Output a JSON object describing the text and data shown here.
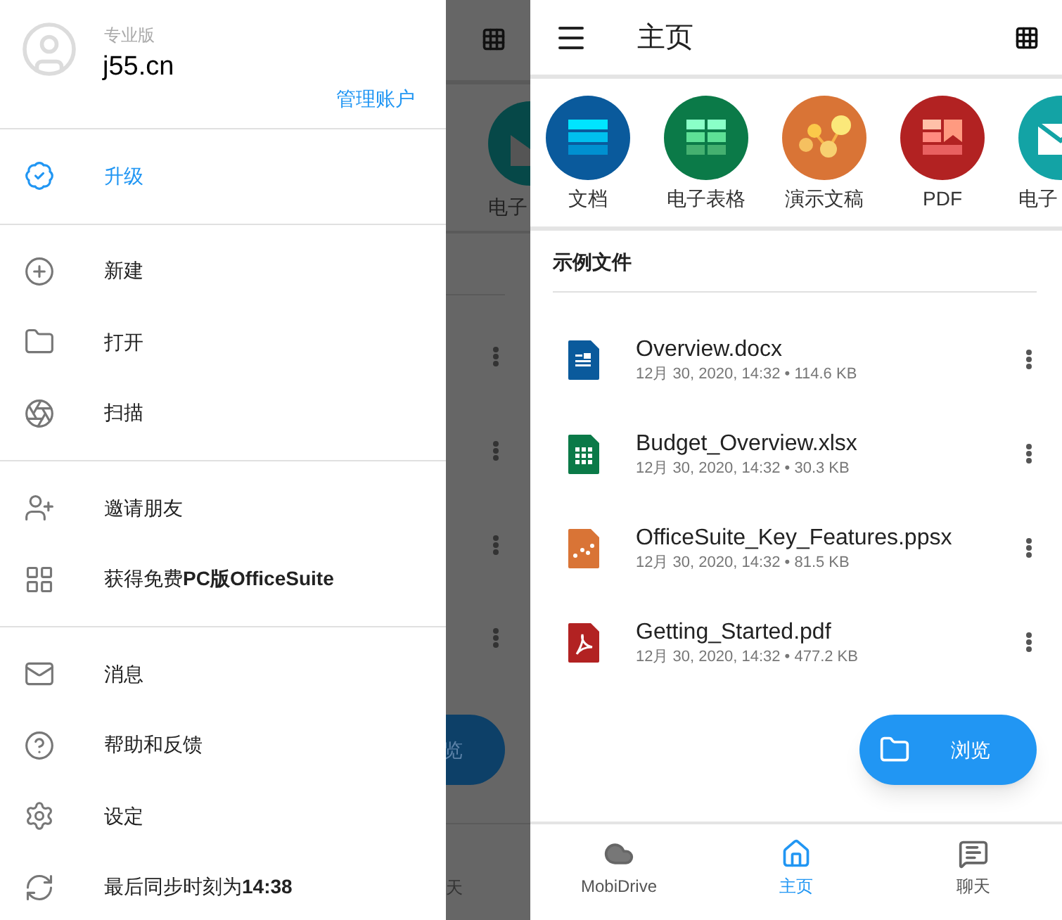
{
  "left_screen": {
    "drawer": {
      "edition": "专业版",
      "account": "j55.cn",
      "manage_link": "管理账户",
      "sections": [
        [
          {
            "label": "升级",
            "kind": "upgrade",
            "highlighted": true
          }
        ],
        [
          {
            "label": "新建",
            "kind": "new",
            "highlighted": false
          },
          {
            "label": "打开",
            "kind": "open",
            "highlighted": false
          },
          {
            "label": "扫描",
            "kind": "scan",
            "highlighted": false
          }
        ],
        [
          {
            "label": "邀请朋友",
            "kind": "invite",
            "highlighted": false
          },
          {
            "label": "获得免费**PC版OfficeSuite**",
            "kind": "windows",
            "highlighted": false
          }
        ],
        [
          {
            "label": "消息",
            "kind": "mail",
            "highlighted": false
          },
          {
            "label": "帮助和反馈",
            "kind": "help",
            "highlighted": false
          },
          {
            "label": "设定",
            "kind": "settings",
            "highlighted": false
          },
          {
            "label": "最后同步时刻为**14:38**",
            "kind": "sync",
            "highlighted": false
          }
        ]
      ]
    },
    "background": {
      "tile_label": "电子",
      "fab_label": "览",
      "nav_label": "天"
    }
  },
  "right_screen": {
    "title": "主页",
    "categories": [
      {
        "label": "文档",
        "kind": "doc"
      },
      {
        "label": "电子表格",
        "kind": "sheet"
      },
      {
        "label": "演示文稿",
        "kind": "slides"
      },
      {
        "label": "PDF",
        "kind": "pdf"
      },
      {
        "label": "电子",
        "kind": "mail"
      }
    ],
    "section_title": "示例文件",
    "files": [
      {
        "name": "Overview.docx",
        "meta": "12月 30, 2020, 14:32 • 114.6 KB",
        "kind": "doc"
      },
      {
        "name": "Budget_Overview.xlsx",
        "meta": "12月 30, 2020, 14:32 • 30.3 KB",
        "kind": "sheet"
      },
      {
        "name": "OfficeSuite_Key_Features.ppsx",
        "meta": "12月 30, 2020, 14:32 • 81.5 KB",
        "kind": "slides"
      },
      {
        "name": "Getting_Started.pdf",
        "meta": "12月 30, 2020, 14:32 • 477.2 KB",
        "kind": "pdf"
      }
    ],
    "fab": "浏览",
    "nav": [
      {
        "label": "MobiDrive",
        "kind": "cloud",
        "selected": false
      },
      {
        "label": "主页",
        "kind": "home",
        "selected": true
      },
      {
        "label": "聊天",
        "kind": "chat",
        "selected": false
      }
    ]
  }
}
